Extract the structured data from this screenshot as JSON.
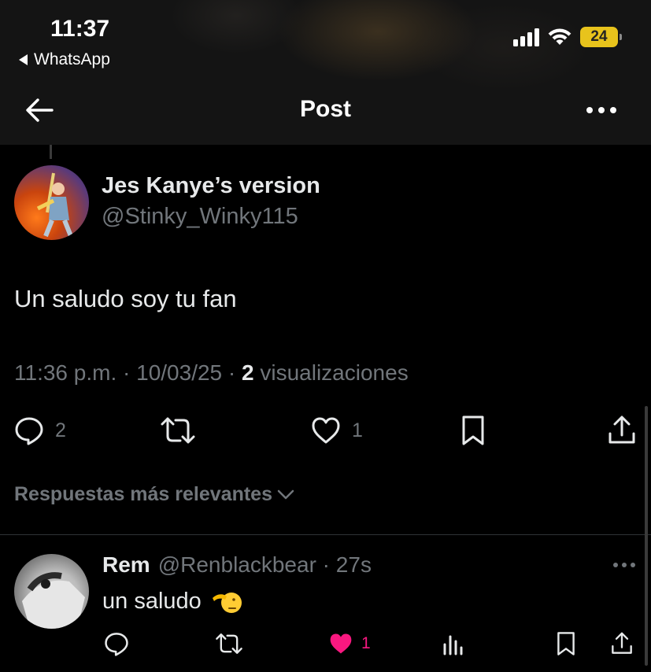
{
  "status_bar": {
    "time": "11:37",
    "back_app": "WhatsApp",
    "battery_level": "24",
    "battery_color": "#e8c31c"
  },
  "header": {
    "title": "Post"
  },
  "post": {
    "author_name": "Jes Kanye’s version",
    "author_handle": "@Stinky_Winky115",
    "text": "Un saludo soy tu fan",
    "time": "11:36 p.m.",
    "date": "10/03/25",
    "views_count": "2",
    "views_label": "visualizaciones",
    "reply_count": "2",
    "like_count": "1",
    "icons": [
      "reply-icon",
      "repost-icon",
      "like-icon",
      "bookmark-icon",
      "share-icon"
    ]
  },
  "replies_section": {
    "sort_label": "Respuestas más relevantes"
  },
  "reply": {
    "name": "Rem",
    "handle": "@Renblackbear",
    "time": "27s",
    "text": "un saludo",
    "like_count": "1",
    "like_color": "#f91880",
    "icons": [
      "reply-icon",
      "repost-icon",
      "like-icon",
      "views-icon",
      "bookmark-icon",
      "share-icon"
    ]
  },
  "colors": {
    "background": "#000000",
    "text_primary": "#e7e9ea",
    "text_secondary": "#71767b",
    "divider": "#2f3336"
  }
}
